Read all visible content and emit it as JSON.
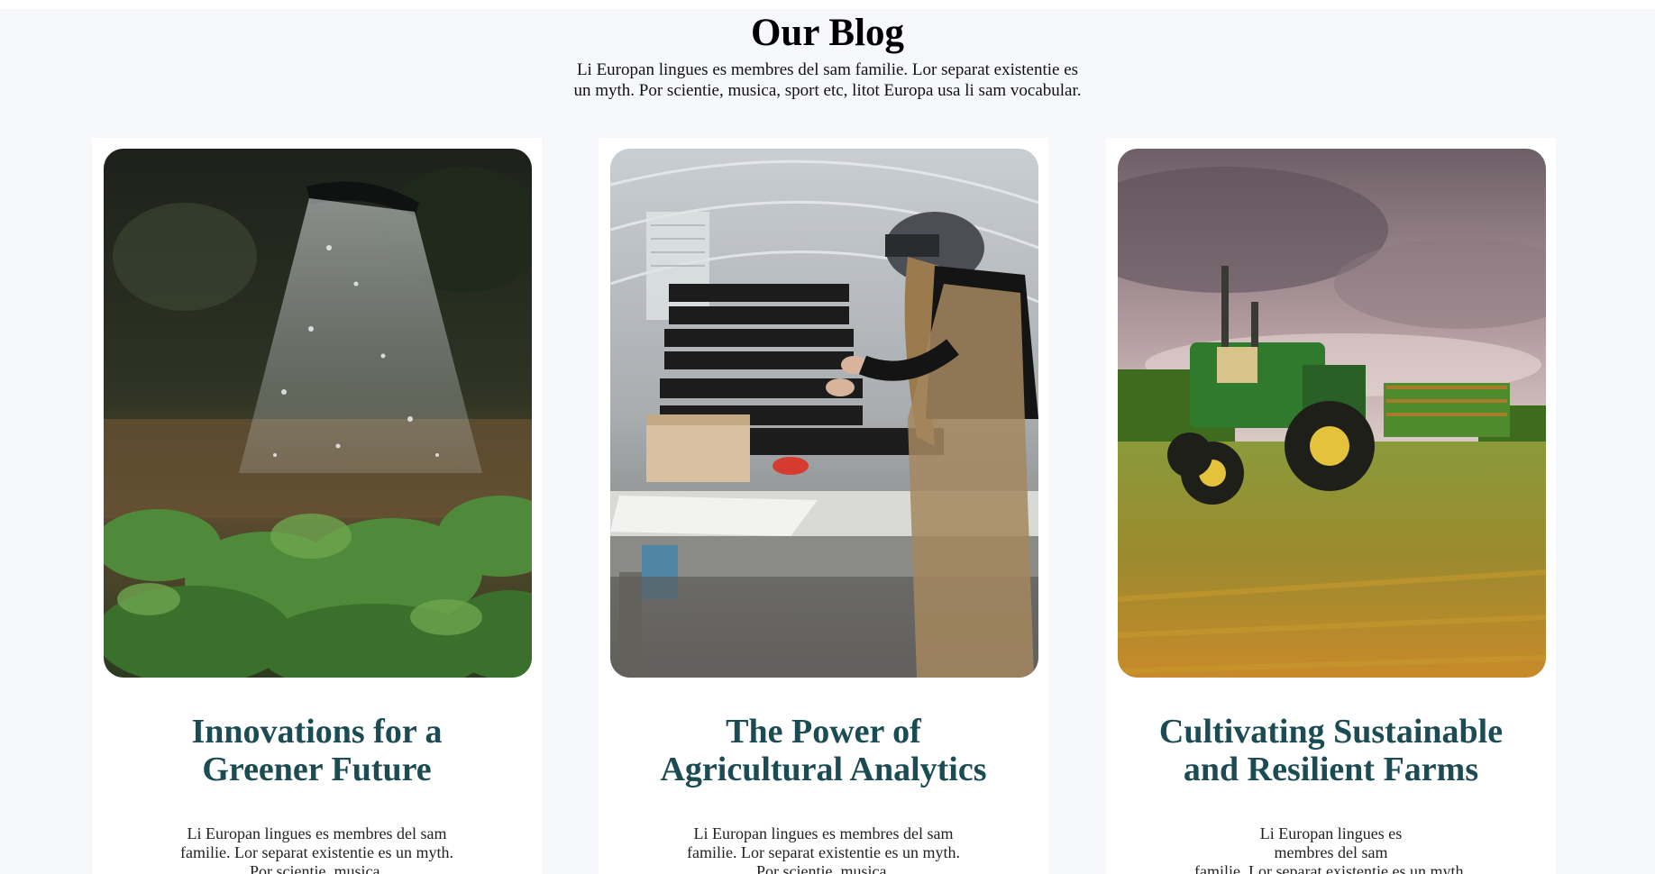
{
  "blog": {
    "title": "Our Blog",
    "intro_line1": "Li Europan lingues es membres del sam familie. Lor separat existentie es",
    "intro_line2": "un myth. Por scientie, musica, sport etc, litot Europa usa li sam vocabular."
  },
  "cards": [
    {
      "image_icon": "watering-can-garden-photo",
      "title_line1": "Innovations for a",
      "title_line2": "Greener Future",
      "text_line1": "Li Europan lingues es membres del sam",
      "text_line2": "familie. Lor separat existentie es un myth.",
      "text_line3": "Por scientie, musica,"
    },
    {
      "image_icon": "greenhouse-seedling-photo",
      "title_line1": "The Power of",
      "title_line2": "Agricultural Analytics",
      "text_line1": "Li Europan lingues es membres del sam",
      "text_line2": "familie. Lor separat existentie es un myth.",
      "text_line3": "Por scientie, musica,"
    },
    {
      "image_icon": "tractor-field-photo",
      "title_line1": "Cultivating Sustainable",
      "title_line2": "and Resilient Farms",
      "text_line1": "Li Europan lingues es",
      "text_line2": "membres del sam",
      "text_line3": "familie. Lor separat existentie es un myth."
    }
  ],
  "colors": {
    "page_background": "#f7f8fc",
    "card_background": "#ffffff",
    "card_title": "#1b4c53",
    "heading": "#000000"
  }
}
